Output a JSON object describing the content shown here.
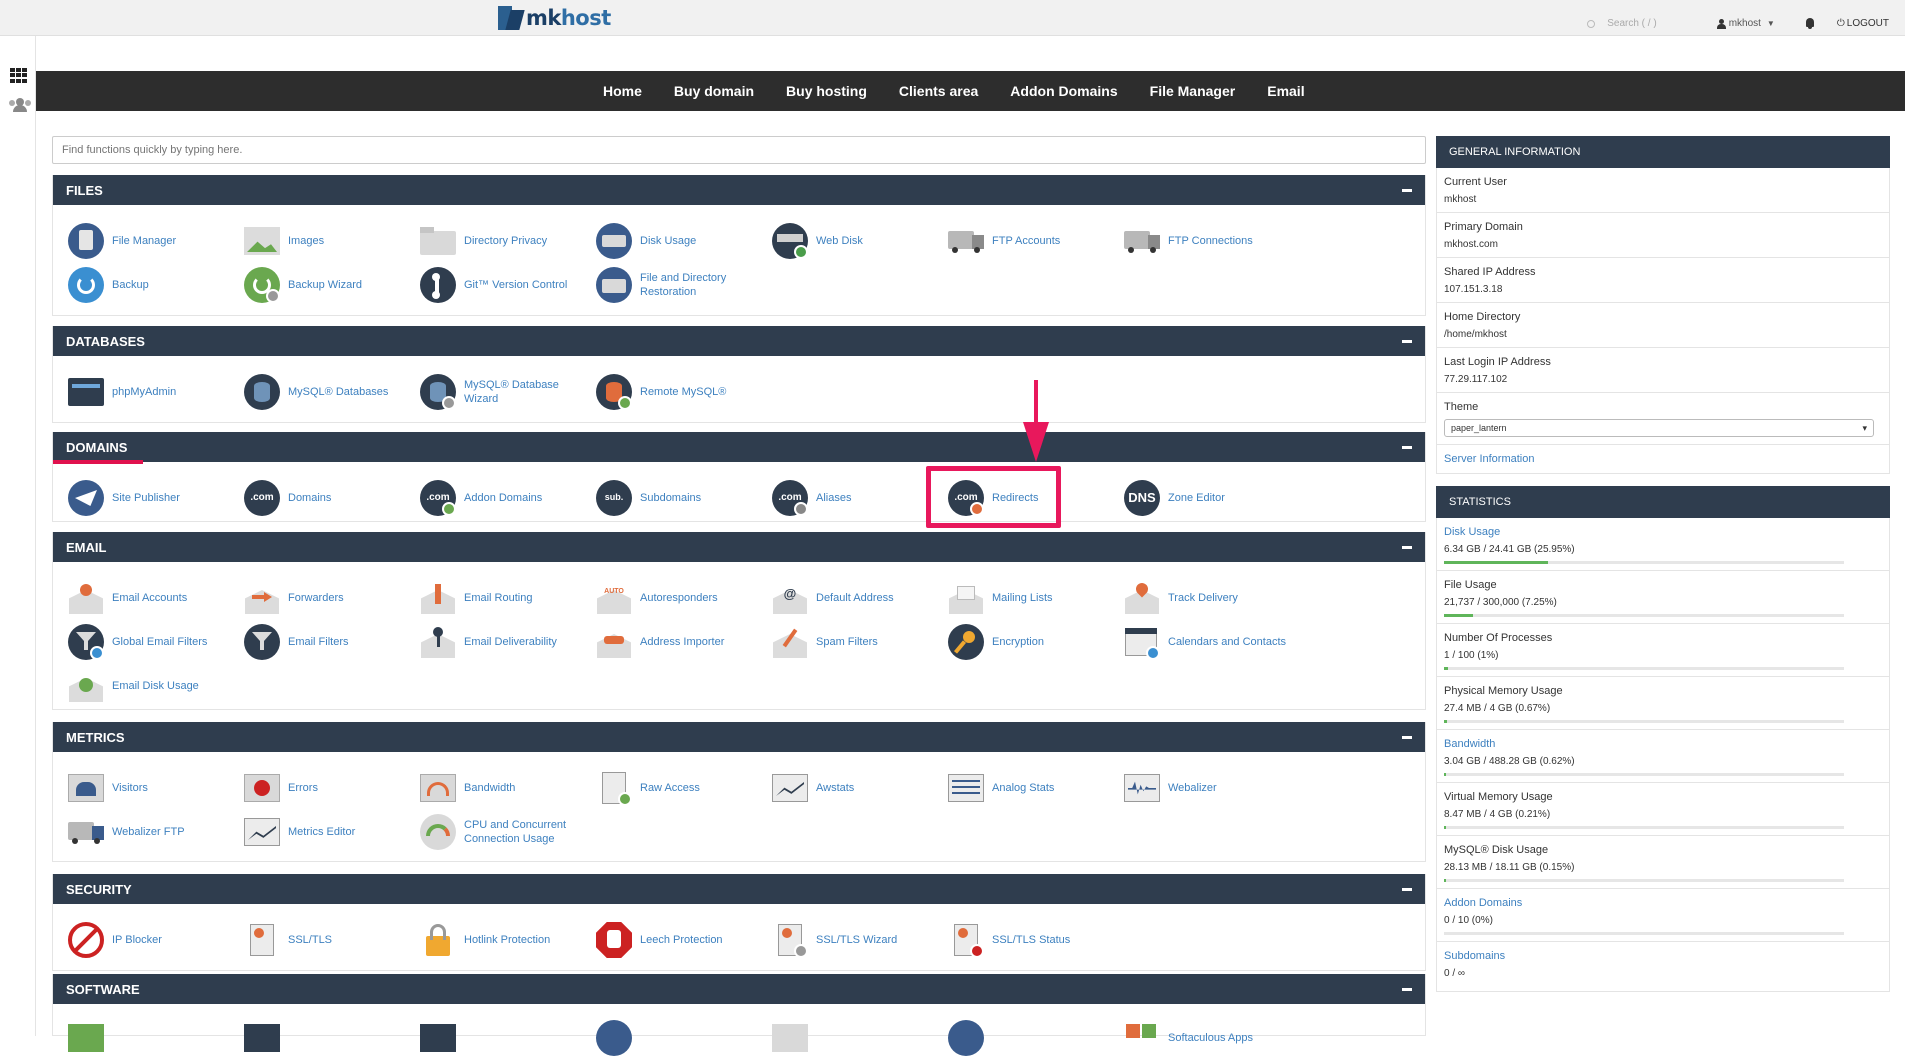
{
  "header": {
    "logo_text_mk": "mk",
    "logo_text_host": "host",
    "search_placeholder": "Search ( / )",
    "user_label": "mkhost",
    "logout_label": "LOGOUT"
  },
  "nav": {
    "items": [
      "Home",
      "Buy domain",
      "Buy hosting",
      "Clients area",
      "Addon Domains",
      "File Manager",
      "Email"
    ]
  },
  "quick_search": {
    "placeholder": "Find functions quickly by typing here."
  },
  "sections": {
    "files": {
      "title": "FILES",
      "items": [
        "File Manager",
        "Images",
        "Directory Privacy",
        "Disk Usage",
        "Web Disk",
        "FTP Accounts",
        "FTP Connections",
        "Backup",
        "Backup Wizard",
        "Git™ Version Control",
        "File and Directory Restoration"
      ]
    },
    "databases": {
      "title": "DATABASES",
      "items": [
        "phpMyAdmin",
        "MySQL® Databases",
        "MySQL® Database Wizard",
        "Remote MySQL®"
      ]
    },
    "domains": {
      "title": "DOMAINS",
      "items": [
        "Site Publisher",
        "Domains",
        "Addon Domains",
        "Subdomains",
        "Aliases",
        "Redirects",
        "Zone Editor"
      ]
    },
    "email": {
      "title": "EMAIL",
      "items": [
        "Email Accounts",
        "Forwarders",
        "Email Routing",
        "Autoresponders",
        "Default Address",
        "Mailing Lists",
        "Track Delivery",
        "Global Email Filters",
        "Email Filters",
        "Email Deliverability",
        "Address Importer",
        "Spam Filters",
        "Encryption",
        "Calendars and Contacts",
        "Email Disk Usage"
      ]
    },
    "metrics": {
      "title": "METRICS",
      "items": [
        "Visitors",
        "Errors",
        "Bandwidth",
        "Raw Access",
        "Awstats",
        "Analog Stats",
        "Webalizer",
        "Webalizer FTP",
        "Metrics Editor",
        "CPU and Concurrent Connection Usage"
      ]
    },
    "security": {
      "title": "SECURITY",
      "items": [
        "IP Blocker",
        "SSL/TLS",
        "Hotlink Protection",
        "Leech Protection",
        "SSL/TLS Wizard",
        "SSL/TLS Status"
      ]
    },
    "software": {
      "title": "SOFTWARE",
      "items": [
        "Softaculous Apps"
      ]
    }
  },
  "icon_text": {
    "com": ".com",
    "sub": "sub.",
    "dns": "DNS",
    "auto": "AUTO",
    "at": "@"
  },
  "general_info": {
    "title": "GENERAL INFORMATION",
    "rows": [
      {
        "k": "Current User",
        "v": "mkhost"
      },
      {
        "k": "Primary Domain",
        "v": "mkhost.com"
      },
      {
        "k": "Shared IP Address",
        "v": "107.151.3.18"
      },
      {
        "k": "Home Directory",
        "v": "/home/mkhost"
      },
      {
        "k": "Last Login IP Address",
        "v": "77.29.117.102"
      }
    ],
    "theme_label": "Theme",
    "theme_value": "paper_lantern",
    "server_info_link": "Server Information"
  },
  "statistics": {
    "title": "STATISTICS",
    "rows": [
      {
        "k": "Disk Usage",
        "v": "6.34 GB / 24.41 GB   (25.95%)",
        "fraction": 0.2595,
        "link": true
      },
      {
        "k": "File Usage",
        "v": "21,737 / 300,000   (7.25%)",
        "fraction": 0.0725,
        "link": false
      },
      {
        "k": "Number Of Processes",
        "v": "1 / 100   (1%)",
        "fraction": 0.01,
        "link": false
      },
      {
        "k": "Physical Memory Usage",
        "v": "27.4 MB / 4 GB   (0.67%)",
        "fraction": 0.0067,
        "link": false
      },
      {
        "k": "Bandwidth",
        "v": "3.04 GB / 488.28 GB   (0.62%)",
        "fraction": 0.0062,
        "link": true
      },
      {
        "k": "Virtual Memory Usage",
        "v": "8.47 MB / 4 GB   (0.21%)",
        "fraction": 0.0021,
        "link": false
      },
      {
        "k": "MySQL® Disk Usage",
        "v": "28.13 MB / 18.11 GB   (0.15%)",
        "fraction": 0.0015,
        "link": false
      },
      {
        "k": "Addon Domains",
        "v": "0 / 10   (0%)",
        "fraction": 0,
        "link": true
      },
      {
        "k": "Subdomains",
        "v": "0 / ∞",
        "fraction": 0,
        "link": true
      }
    ]
  },
  "colors": {
    "nav_bg": "#2d2d2d",
    "panel_head": "#2f3d4e",
    "link": "#3d80bf",
    "highlight": "#e8185c",
    "bar_fill": "#5fb55a"
  }
}
